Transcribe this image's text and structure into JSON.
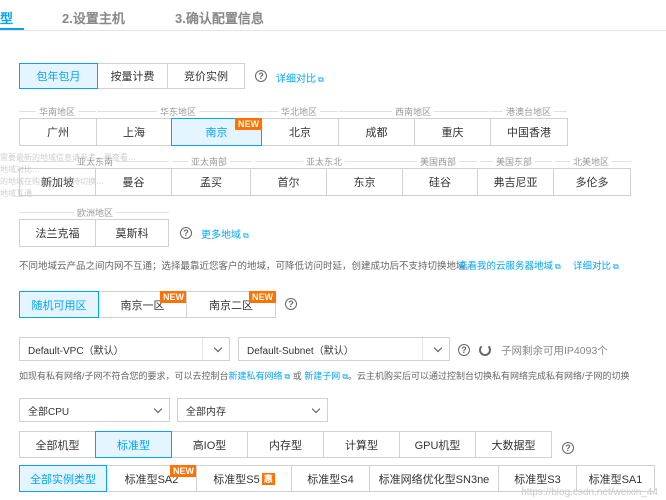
{
  "steps": {
    "step1": "型",
    "step2": "2.设置主机",
    "step3": "3.确认配置信息"
  },
  "billing": {
    "options": [
      "包年包月",
      "按量计费",
      "竞价实例"
    ],
    "detail_link": "详细对比"
  },
  "regions": {
    "groups_row1": [
      "华南地区",
      "华东地区",
      "华北地区",
      "西南地区",
      "港澳台地区"
    ],
    "row1": [
      "广州",
      "上海",
      "南京",
      "北京",
      "成都",
      "重庆",
      "中国香港"
    ],
    "groups_row2": [
      "亚太东南",
      "亚太南部",
      "亚太东北",
      "美国西部",
      "美国东部",
      "北美地区"
    ],
    "row2": [
      "新加坡",
      "曼谷",
      "孟买",
      "首尔",
      "东京",
      "硅谷",
      "弗吉尼亚",
      "多伦多"
    ],
    "group_row3": "欧洲地区",
    "row3": [
      "法兰克福",
      "莫斯科"
    ],
    "new_badge": "NEW",
    "more_link": "更多地域",
    "notice": "不同地域云产品之间内网不互通；选择最靠近您客户的地域，可降低访问时延，创建成功后不支持切换地域。",
    "my_servers_link": "查看我的云服务器地域",
    "detail_link": "详细对比"
  },
  "overlay_text": [
    "需要最新的地域信息请参考…要查看…",
    "地域对比…",
    "的地域在购买后不支持切换…",
    "地域互通…"
  ],
  "zones": {
    "options": [
      "随机可用区",
      "南京一区",
      "南京二区"
    ],
    "new_badge": "NEW"
  },
  "network": {
    "vpc": "Default-VPC（默认）",
    "subnet": "Default-Subnet（默认）",
    "ip_remaining": "子网剩余可用IP4093个",
    "hint_prefix": "如现有私有网络/子网不符合您的要求，可以去控制台",
    "create_vpc": "新建私有网络",
    "hint_or": "或",
    "create_subnet": "新建子网",
    "hint_suffix": "。云主机购买后可以通过控制台切换私有网络完成私有网络/子网的切换"
  },
  "filters": {
    "cpu": "全部CPU",
    "memory": "全部内存"
  },
  "families": [
    "全部机型",
    "标准型",
    "高IO型",
    "内存型",
    "计算型",
    "GPU机型",
    "大数据型"
  ],
  "types": {
    "items": [
      "全部实例类型",
      "标准型SA2",
      "标准型S5",
      "标准型S4",
      "标准网络优化型SN3ne",
      "标准型S3",
      "标准型SA1"
    ],
    "new_badge": "NEW",
    "hui_badge": "惠"
  },
  "watermark": "https://blog.csdn.net/weixin_44"
}
